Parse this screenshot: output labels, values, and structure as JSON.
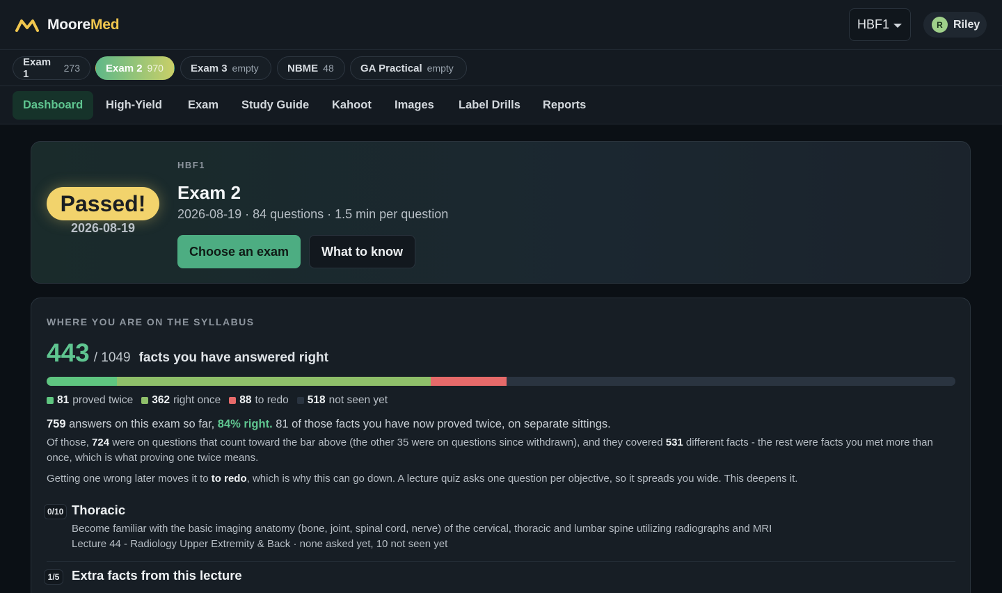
{
  "brand": {
    "name_part1": "Moore",
    "name_part2": "Med",
    "logo_icon": "m-logo-icon",
    "accent": "#f0c64e"
  },
  "header": {
    "course_select": {
      "value": "HBF1",
      "icon": "caret-down-icon"
    },
    "user": {
      "initial": "R",
      "name": "Riley"
    }
  },
  "exam_tabs": [
    {
      "label": "Exam 1",
      "count": "273",
      "active": false
    },
    {
      "label": "Exam 2",
      "count": "970",
      "active": true
    },
    {
      "label": "Exam 3",
      "count": "empty",
      "active": false
    },
    {
      "label": "NBME",
      "count": "48",
      "active": false
    },
    {
      "label": "GA Practical",
      "count": "empty",
      "active": false
    }
  ],
  "nav": {
    "items": [
      "Dashboard",
      "High-Yield",
      "Exam",
      "Study Guide",
      "Kahoot",
      "Images",
      "Label Drills",
      "Reports"
    ],
    "active": "Dashboard"
  },
  "hero": {
    "badge": "Passed!",
    "badge_date": "2026-08-19",
    "course": "HBF1",
    "title": "Exam 2",
    "meta": "2026-08-19 · 84 questions · 1.5 min per question",
    "primary_button": "Choose an exam",
    "secondary_button": "What to know"
  },
  "syllabus": {
    "heading": "WHERE YOU ARE ON THE SYLLABUS",
    "answered_right": "443",
    "total": "/ 1049",
    "caption": "facts you have answered right",
    "progress": {
      "total": 1049,
      "segments": [
        {
          "key": "proved_twice",
          "value": 81,
          "color": "#5fc580"
        },
        {
          "key": "right_once",
          "value": 362,
          "color": "#8fbf6a"
        },
        {
          "key": "to_redo",
          "value": 88,
          "color": "#e66a6a"
        },
        {
          "key": "not_seen",
          "value": 518,
          "color": "#2a3440"
        }
      ]
    },
    "legend": [
      {
        "value": "81",
        "label": "proved twice",
        "color": "#5fc580"
      },
      {
        "value": "362",
        "label": "right once",
        "color": "#8fbf6a"
      },
      {
        "value": "88",
        "label": "to redo",
        "color": "#e66a6a"
      },
      {
        "value": "518",
        "label": "not seen yet",
        "color": "#2a3440"
      }
    ],
    "para1": {
      "answers": "759",
      "t1": " answers on this exam so far, ",
      "pct": "84% right.",
      "t2": " 81 of those facts you have now proved twice, on separate sittings."
    },
    "para2": {
      "t1": "Of those, ",
      "n1": "724",
      "t2": " were on questions that count toward the bar above (the other 35 were on questions since withdrawn), and they covered ",
      "n2": "531",
      "t3": " different facts - the rest were facts you met more than once, which is what proving one twice means."
    },
    "para3": {
      "t1": "Getting one wrong later moves it to ",
      "b1": "to redo",
      "t2": ", which is why this can go down. A lecture quiz asks one question per objective, so it spreads you wide. This deepens it."
    },
    "objectives": [
      {
        "badge": "0/10",
        "title": "Thoracic",
        "desc": "Become familiar with the basic imaging anatomy (bone, joint, spinal cord, nerve) of the cervical, thoracic and lumbar spine utilizing radiographs and MRI",
        "meta": "Lecture 44 - Radiology Upper Extremity & Back · none asked yet, 10 not seen yet"
      },
      {
        "badge": "1/5",
        "title": "Extra facts from this lecture"
      }
    ]
  }
}
